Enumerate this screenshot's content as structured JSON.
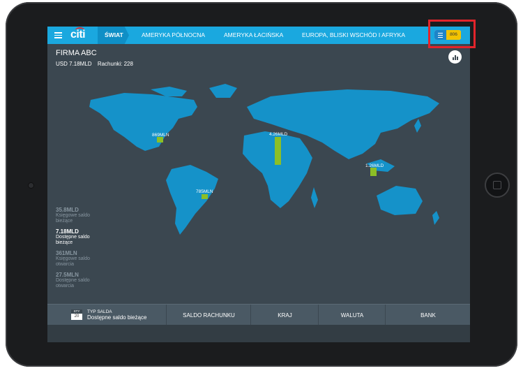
{
  "nav": {
    "logo": "citi",
    "active_tab": "ŚWIAT",
    "tabs": [
      "AMERYKA PÓŁNOCNA",
      "AMERYKA ŁACIŃSKA",
      "EUROPA, BLISKI WSCHÓD I AFRYKA"
    ],
    "toggle_value": "806"
  },
  "company": {
    "name": "FIRMA ABC",
    "total": "USD 7.18MLD",
    "accounts": "Rachunki: 228"
  },
  "map": {
    "markers": [
      {
        "label": "869MLN",
        "value_mln": 869
      },
      {
        "label": "4.26MLD",
        "value_mln": 4260
      },
      {
        "label": "1.26MLD",
        "value_mln": 1260
      },
      {
        "label": "785MLN",
        "value_mln": 785
      }
    ]
  },
  "stats": [
    {
      "value": "35.8MLD",
      "label1": "Księgowe saldo",
      "label2": "bieżące",
      "active": false
    },
    {
      "value": "7.18MLD",
      "label1": "Dostępne saldo",
      "label2": "bieżące",
      "active": true
    },
    {
      "value": "361MLN",
      "label1": "Księgowe saldo",
      "label2": "otwarcia",
      "active": false
    },
    {
      "value": "27.5MLN",
      "label1": "Dostępne saldo",
      "label2": "otwarcia",
      "active": false
    }
  ],
  "bottom": {
    "calendar_month": "STY",
    "calendar_day": "20",
    "type_label": "TYP SALDA",
    "type_value": "Dostępne saldo bieżące",
    "columns": [
      "SALDO RACHUNKU",
      "KRAJ",
      "WALUTA",
      "BANK"
    ]
  },
  "colors": {
    "topbar": "#1aa8df",
    "background": "#3b4750",
    "land": "#1592c9",
    "marker": "#8cbf26",
    "highlight": "#e3242b",
    "toggle_accent": "#f2c300"
  }
}
